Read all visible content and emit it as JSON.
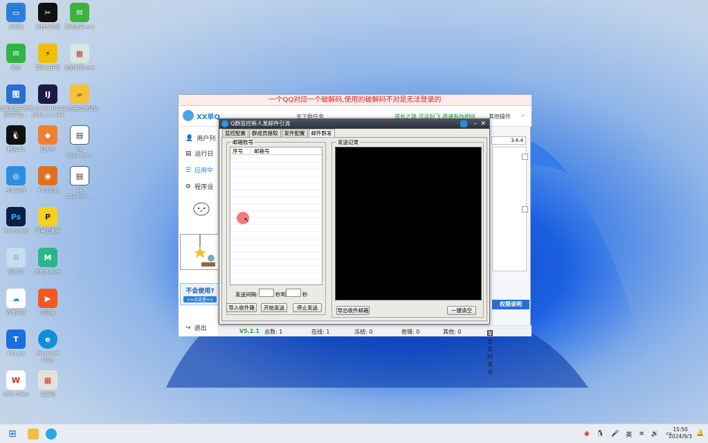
{
  "desktop": {
    "icons": [
      {
        "label": "此电脑",
        "color": "#2a7fd8",
        "glyph": "▭"
      },
      {
        "label": "剪映专业版",
        "color": "#111111",
        "glyph": "✂"
      },
      {
        "label": "微信多开.exe",
        "color": "#3db33d",
        "glyph": "✉"
      },
      {
        "label": "微信",
        "color": "#2db742",
        "glyph": "✉"
      },
      {
        "label": "雷军分开宝",
        "color": "#f0c000",
        "glyph": "⚡"
      },
      {
        "label": "拍拍科技.exe",
        "color": "#d8e6e0",
        "glyph": "▦"
      },
      {
        "label": "图级类电子商务\n应用平台...",
        "color": "#2a6fd0",
        "glyph": "图"
      },
      {
        "label": "IntelliJ IDEA\n2021.1.1 x64",
        "color": "#1a1a4a",
        "glyph": "IJ"
      },
      {
        "label": "QQ注册引流营销",
        "color": "#f3c13a",
        "glyph": "▰"
      },
      {
        "label": "腾讯QQ",
        "color": "#111111",
        "glyph": "🐧"
      },
      {
        "label": "石大师",
        "color": "#f08030",
        "glyph": "◆"
      },
      {
        "label": "xx\n2024-09-...",
        "color": "#ffffff",
        "glyph": "▤"
      },
      {
        "label": "全能云盘",
        "color": "#2a8fe0",
        "glyph": "◎"
      },
      {
        "label": "XX浏览机",
        "color": "#e07020",
        "glyph": "◉"
      },
      {
        "label": "xx\n2024-09-...",
        "color": "#ffffff",
        "glyph": "▤"
      },
      {
        "label": "Photoshop",
        "color": "#0a1f44",
        "glyph": "Ps"
      },
      {
        "label": "雷神加速器",
        "color": "#f5d020",
        "glyph": "P"
      },
      {
        "label": "回收站",
        "color": "#c8dcf0",
        "glyph": "♲"
      },
      {
        "label": "剪辑Master",
        "color": "#2bb58a",
        "glyph": "M"
      },
      {
        "label": "百度网盘",
        "color": "#ffffff",
        "glyph": "☁"
      },
      {
        "label": "向日葵",
        "color": "#f05a20",
        "glyph": "▶"
      },
      {
        "label": "ToDesk",
        "color": "#1a6fe0",
        "glyph": "T"
      },
      {
        "label": "Microsoft\nEdge",
        "color": "#0f8fd8",
        "glyph": "e"
      },
      {
        "label": "WPS Office",
        "color": "#d8281c",
        "glyph": "W"
      },
      {
        "label": "易源码",
        "color": "#e8e0d8",
        "glyph": "▦"
      }
    ]
  },
  "mainwin": {
    "banner": "一个QQ对应一个破解码,使用的破解码不对是无法登录的",
    "logo": "XX单Q",
    "header_items": [
      "天下群任务",
      "成长之路 沉淀起飞 邀请有你相伴",
      "其他操作"
    ],
    "sidebar": [
      "用户列",
      "运行日",
      "应用中",
      "程序设"
    ],
    "help_title": "不会使用?",
    "help_link": ">>点这里<<",
    "exit": "退出",
    "version_field": "3.6.4",
    "perm_button": "权限说明",
    "status": {
      "version": "V5.2.1",
      "total": "总数: 1",
      "online": "在线: 1",
      "frozen": "冻结: 0",
      "password": "密错: 0",
      "other": "其他: 0",
      "log_scroll": "日志实时滚动"
    }
  },
  "dialog": {
    "title": "Q群监控新人发邮件引流",
    "tabs": [
      "监控配置",
      "群成员提取",
      "发件配置",
      "邮件群发"
    ],
    "active_tab": 3,
    "mailbox_group": "邮箱账号",
    "col_index": "序号",
    "col_mail": "邮箱号",
    "interval_label": "发送间隔:",
    "interval_to": "秒到",
    "interval_unit": "秒",
    "btn_import": "导入收件箱",
    "btn_start": "开始发送",
    "btn_stop": "停止发送",
    "send_log_group": "发送记录",
    "btn_export": "导出收件邮箱",
    "btn_clear": "一键清空"
  },
  "taskbar": {
    "lang": "英",
    "time": "15:50",
    "date": "2024/9/3"
  }
}
